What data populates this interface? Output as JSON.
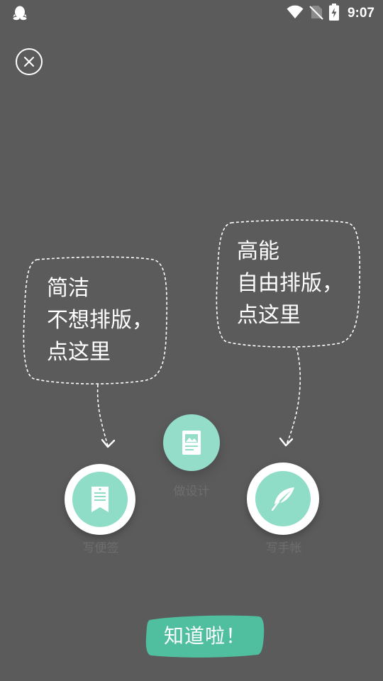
{
  "status_bar": {
    "time": "9:07",
    "left_icon": "qq-penguin-icon",
    "icons": [
      "wifi-icon",
      "no-sim-icon",
      "battery-charging-icon"
    ]
  },
  "close_button": {
    "icon": "close-icon"
  },
  "bubbles": {
    "left": {
      "lines": [
        "简洁",
        "不想排版，",
        "点这里"
      ]
    },
    "right": {
      "lines": [
        "高能",
        "自由排版，",
        "点这里"
      ]
    }
  },
  "actions": {
    "note": {
      "label": "写便签",
      "icon": "bookmark-note-icon"
    },
    "design": {
      "label": "做设计",
      "icon": "image-document-icon"
    },
    "journal": {
      "label": "写手帐",
      "icon": "feather-icon"
    }
  },
  "got_it_button": {
    "label": "知道啦！"
  },
  "colors": {
    "overlay_background": "#5b5b5b",
    "accent_mint": "#8fdcc7",
    "button_teal": "#4fbf9f",
    "label_gray": "#6e6e6e"
  }
}
